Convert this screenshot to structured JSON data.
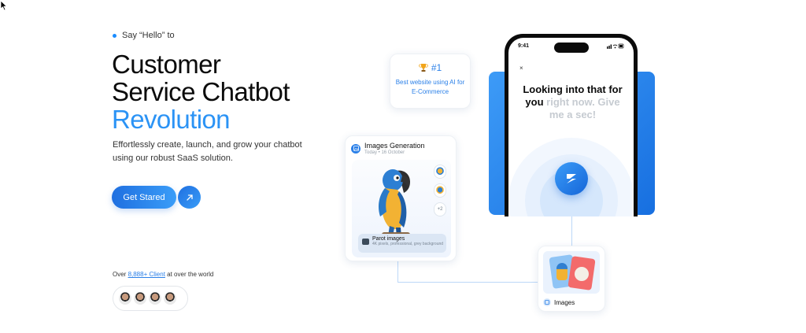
{
  "hero": {
    "eyebrow": "Say “Hello” to",
    "headline_line1": "Customer",
    "headline_line2": "Service Chatbot",
    "headline_accent": "Revolution",
    "description": "Effortlessly create, launch, and grow your chatbot using our robust SaaS solution.",
    "cta_label": "Get Stared",
    "clients_prefix": "Over ",
    "clients_link": "8,888+ Client",
    "clients_suffix": " at over the world"
  },
  "rank_card": {
    "rank": "#1",
    "caption": "Best website using AI for E-Commerce"
  },
  "images_card": {
    "title": "Images Generation",
    "meta": "Today  •  16 October",
    "more_count": "+2",
    "prompt_title": "Parot images",
    "prompt_detail": "4K pixels, professional, grey background"
  },
  "phone": {
    "time": "9:41",
    "close": "×",
    "message_dark": "Looking into that for you",
    "message_faded": " right now. Give me a sec!"
  },
  "generated_card": {
    "label": "Images"
  },
  "colors": {
    "accent": "#2b93f5",
    "button": "#1f6fe0"
  }
}
